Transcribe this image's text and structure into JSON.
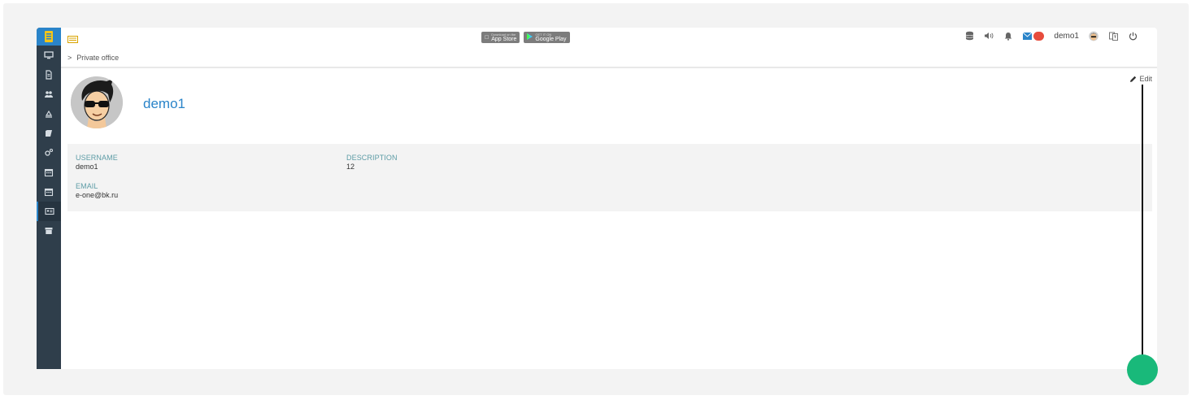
{
  "header": {
    "app_store": {
      "small": "Download on the",
      "large": "App Store"
    },
    "google_play": {
      "small": "GET IT ON",
      "large": "Google Play"
    },
    "user_name": "demo1"
  },
  "breadcrumb": {
    "separator": ">",
    "current": "Private office"
  },
  "profile": {
    "name": "demo1",
    "edit_label": "Edit"
  },
  "fields": {
    "username": {
      "label": "USERNAME",
      "value": "demo1"
    },
    "description": {
      "label": "DESCRIPTION",
      "value": "12"
    },
    "email": {
      "label": "EMAIL",
      "value": "e-one@bk.ru"
    }
  },
  "sidebar": {
    "items": [
      "monitor-icon",
      "document-icon",
      "users-icon",
      "layers-icon",
      "book-icon",
      "gears-icon",
      "calendar-icon",
      "calendar-icon",
      "id-card-icon",
      "archive-icon"
    ],
    "active_index": 8
  },
  "colors": {
    "accent": "#2a84c9",
    "sidebar": "#2f3e4b",
    "label": "#5d9ca6",
    "pointer": "#19b97a",
    "badge": "#e74c3c"
  }
}
